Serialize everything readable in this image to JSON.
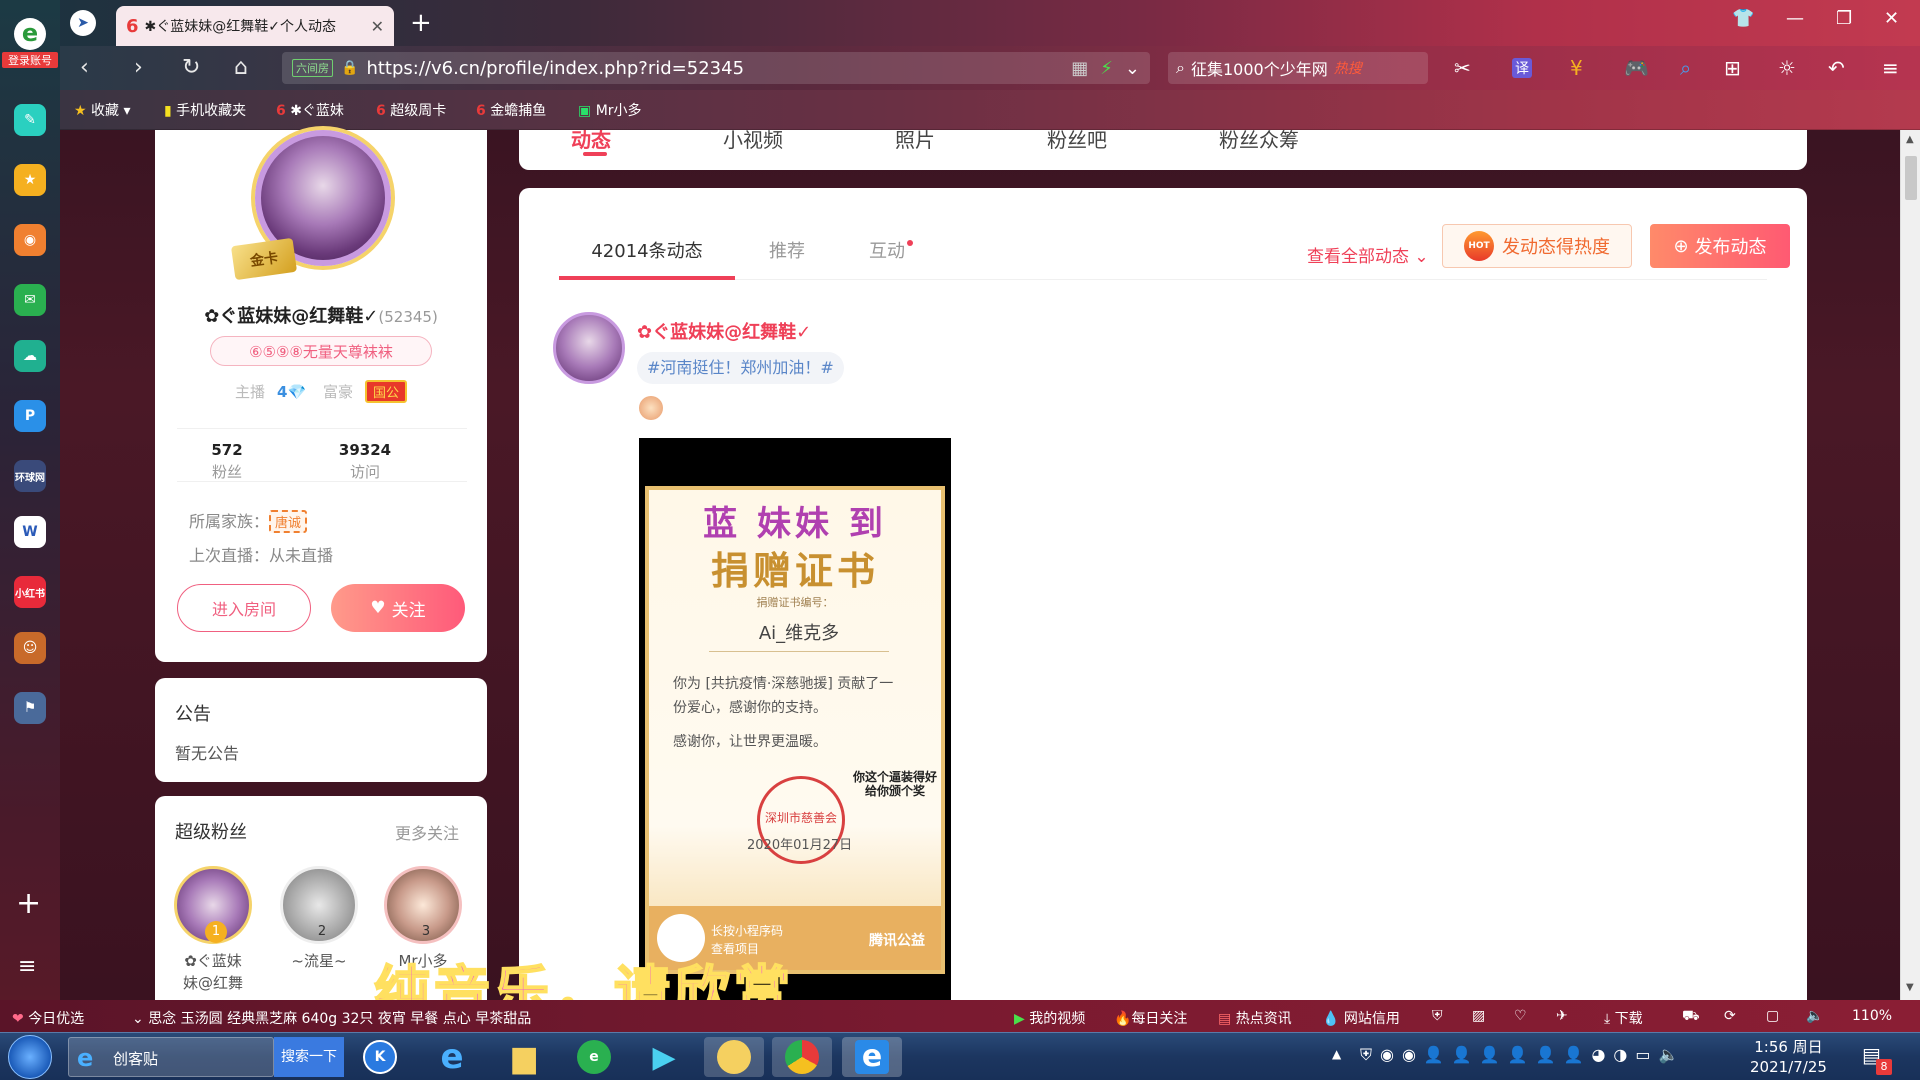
{
  "browser": {
    "side_badge": "登录账号",
    "tab_title": "✱ぐ蓝妹妹@红舞鞋✓个人动态",
    "tab_close": "✕",
    "new_tab": "+",
    "url_badge": "六间房",
    "url": "https://v6.cn/profile/index.php?rid=52345",
    "search_text": "征集1000个少年网",
    "search_hot": "热搜",
    "translate": "译"
  },
  "bookmarks": {
    "items": [
      "收藏",
      "手机收藏夹",
      "✱ぐ蓝妹",
      "超级周卡",
      "金蟾捕鱼",
      "Mr小多"
    ]
  },
  "sidebar_icons": [
    "feather-icon",
    "star-icon",
    "weibo-icon",
    "mail-icon",
    "cloud-icon",
    "p-icon",
    "news-icon",
    "word-icon",
    "xiaohongshu-icon",
    "game-icon",
    "game2-icon"
  ],
  "sidebar_labels": {
    "news": "环球网",
    "xhs": "小红书"
  },
  "profile": {
    "name": "✿ぐ蓝妹妹@红舞鞋✓",
    "rid": "(52345)",
    "tag": "⑥⑤⑨⑧无量天尊袜袜",
    "anchor_label": "主播",
    "anchor_level": "4",
    "rich_label": "富豪",
    "rich_badge": "国公",
    "gold_card": "金卡",
    "fans_count": "572",
    "fans_label": "粉丝",
    "visits_count": "39324",
    "visits_label": "访问",
    "family_label": "所属家族：",
    "family_badge": "唐诚",
    "last_live": "上次直播：从未直播",
    "enter_room": "进入房间",
    "follow": "关注"
  },
  "notice": {
    "title": "公告",
    "text": "暂无公告"
  },
  "super_fans": {
    "title": "超级粉丝",
    "more": "更多关注",
    "fans": [
      {
        "rank": "1",
        "name1": "✿ぐ蓝妹",
        "name2": "妹@红舞"
      },
      {
        "rank": "2",
        "name1": "~流星~",
        "name2": ""
      },
      {
        "rank": "3",
        "name1": "Mr小多",
        "name2": ""
      }
    ]
  },
  "top_nav": [
    "动态",
    "小视频",
    "照片",
    "粉丝吧",
    "粉丝众筹"
  ],
  "feed": {
    "tabs": [
      "42014条动态",
      "推荐",
      "互动"
    ],
    "view_all": "查看全部动态",
    "hot_button": "发动态得热度",
    "hot_badge": "HOT",
    "post_button": "发布动态",
    "post": {
      "author": "✿ぐ蓝妹妹@红舞鞋✓",
      "topic": "#河南挺住！郑州加油！#",
      "cert": {
        "heading": "蓝 妹妹 到",
        "title": "捐赠证书",
        "number_label": "捐赠证书编号：",
        "donor": "Ai_维克多",
        "line1": "你为 [共抗疫情·深慈驰援] 贡献了一",
        "line2": "份爱心，感谢你的支持。",
        "line3": "感谢你，让世界更温暖。",
        "seal": "深圳市慈善会",
        "date": "2020年01月27日",
        "meme1": "你这个逼装得好",
        "meme2": "给你颁个奖",
        "foot1": "长按小程序码",
        "foot2": "查看项目",
        "foot_brand": "腾讯公益"
      }
    }
  },
  "subtitle": "纯音乐，请欣赏",
  "statusbar": {
    "today": "今日优选",
    "ticker": "思念 玉汤圆 经典黑芝麻 640g 32只 夜宵 早餐 点心 早茶甜品",
    "my_video": "我的视频",
    "daily": "每日关注",
    "hot_news": "热点资讯",
    "credit": "网站信用",
    "download": "下载",
    "zoom": "110%"
  },
  "taskbar": {
    "ie_label": "创客贴",
    "search_btn": "搜索一下",
    "time": "1:56 周日",
    "date": "2021/7/25",
    "notif": "8"
  }
}
